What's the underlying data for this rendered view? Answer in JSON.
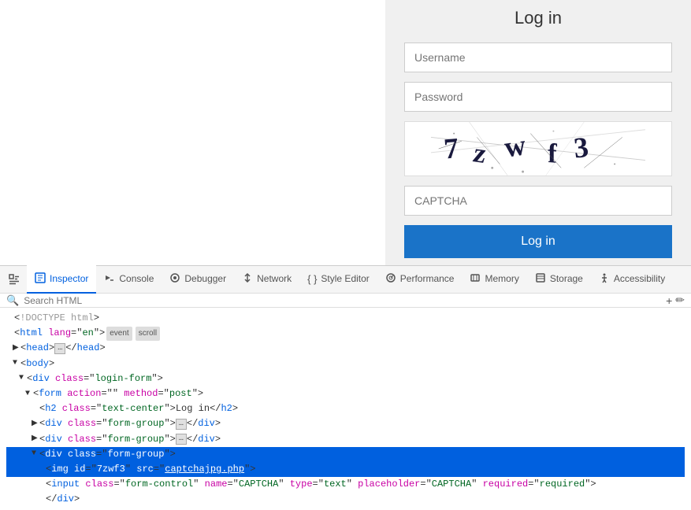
{
  "preview": {
    "login": {
      "title": "Log in",
      "username_placeholder": "Username",
      "password_placeholder": "Password",
      "captcha_placeholder": "CAPTCHA",
      "button_label": "Log in"
    }
  },
  "devtools": {
    "tabs": [
      {
        "id": "pick",
        "label": "",
        "icon": "⬚"
      },
      {
        "id": "inspector",
        "label": "Inspector",
        "icon": "◻",
        "active": true
      },
      {
        "id": "console",
        "label": "Console",
        "icon": "▶"
      },
      {
        "id": "debugger",
        "label": "Debugger",
        "icon": "○"
      },
      {
        "id": "network",
        "label": "Network",
        "icon": "↕"
      },
      {
        "id": "style-editor",
        "label": "Style Editor",
        "icon": "{}"
      },
      {
        "id": "performance",
        "label": "Performance",
        "icon": "◎"
      },
      {
        "id": "memory",
        "label": "Memory",
        "icon": "▣"
      },
      {
        "id": "storage",
        "label": "Storage",
        "icon": "▤"
      },
      {
        "id": "accessibility",
        "label": "Accessibility",
        "icon": "♿"
      }
    ],
    "search": {
      "placeholder": "Search HTML"
    },
    "html_tree": {
      "lines": [
        {
          "indent": 0,
          "content": "<!DOCTYPE html>"
        },
        {
          "indent": 0,
          "content": "<html lang=\"en\"> [event] [scroll]",
          "has_event": true,
          "has_scroll": true
        },
        {
          "indent": 1,
          "content": "▶ <head> … </head>",
          "collapsed": true
        },
        {
          "indent": 1,
          "content": "▼ <body>",
          "open": true
        },
        {
          "indent": 2,
          "content": "▼ <div class=\"login-form\">",
          "open": true
        },
        {
          "indent": 3,
          "content": "▼ <form action=\"\" method=\"post\">",
          "open": true
        },
        {
          "indent": 4,
          "content": "<h2 class=\"text-center\">Log in</h2>"
        },
        {
          "indent": 4,
          "content": "▶ <div class=\"form-group\"> … </div>",
          "collapsed": true
        },
        {
          "indent": 4,
          "content": "▶ <div class=\"form-group\"> … </div>",
          "collapsed": true
        },
        {
          "indent": 4,
          "content": "▼ <div class=\"form-group\">",
          "open": true,
          "highlighted": true
        },
        {
          "indent": 5,
          "content": "<img id=\"7zwf3\" src=\"captchajpg.php\">",
          "highlighted": true
        },
        {
          "indent": 5,
          "content": "<input class=\"form-control\" name=\"CAPTCHA\" type=\"text\" placeholder=\"CAPTCHA\" required=\"required\">"
        },
        {
          "indent": 5,
          "content": "</div>"
        }
      ]
    }
  }
}
